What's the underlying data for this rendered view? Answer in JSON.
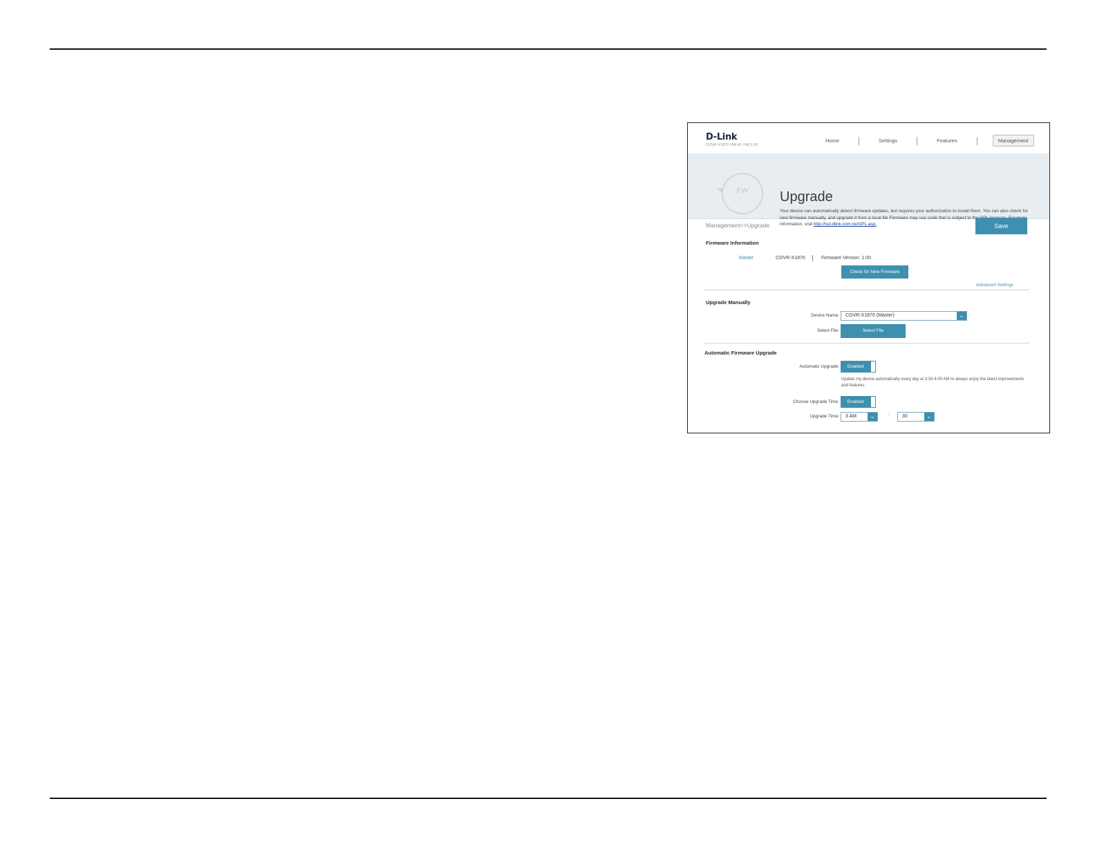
{
  "header": {
    "logo": "D-Link",
    "model": "COVR-X1870 HW:A1 FW:1.00",
    "nav": [
      {
        "label": "Home"
      },
      {
        "label": "Settings"
      },
      {
        "label": "Features"
      },
      {
        "label": "Management",
        "active": true
      }
    ]
  },
  "banner": {
    "icon_label": "FW",
    "title": "Upgrade",
    "description": "Your device can automatically detect firmware updates, but requires your authorization to install them. You can also check for new firmware manually, and upgrade it from a local file Firmware may use code that is subject to the GPL licenses. For more information, visit ",
    "link": "http://tsd.dlink.com.tw/GPL.asp."
  },
  "breadcrumb": "Management>>Upgrade",
  "save_label": "Save",
  "firmware_info": {
    "heading": "Firmware Information",
    "role": "Master",
    "model": "COVR-X1870",
    "version": "Firmware Version: 1.00",
    "check_button": "Check for New Firmware",
    "advanced_link": "Advanced Settings"
  },
  "upgrade_manually": {
    "heading": "Upgrade Manually",
    "device_name_label": "Device Name:",
    "device_name_value": "COVR-X1870 (Master)",
    "select_file_label": "Select File:",
    "select_file_button": "Select File"
  },
  "auto_upgrade": {
    "heading": "Automatic Firmware Upgrade",
    "auto_label": "Automatic Upgrade:",
    "auto_value": "Enabled",
    "note": "Update my device automatically every day at 3:30-4:00 AM to always enjoy the latest improvements and features.",
    "choose_time_label": "Choose Upgrade Time:",
    "choose_time_value": "Enabled",
    "time_label": "Upgrade Time:",
    "hour": "3 AM",
    "minute": "30",
    "separator": ":"
  },
  "colors": {
    "accent": "#3f8fae",
    "banner_bg": "#e8edf1"
  }
}
